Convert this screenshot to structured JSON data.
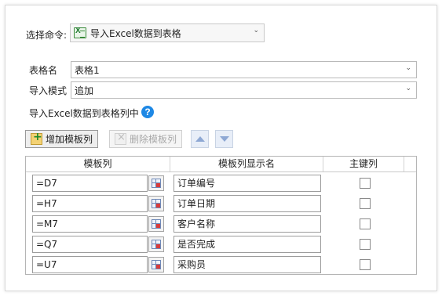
{
  "command": {
    "label": "选择命令:",
    "selected": "导入Excel数据到表格",
    "icon": "excel-import-icon"
  },
  "form": {
    "table_name_label": "表格名",
    "table_name_value": "表格1",
    "import_mode_label": "导入模式",
    "import_mode_value": "追加",
    "section_label": "导入Excel数据到表格列中",
    "help_symbol": "?"
  },
  "toolbar": {
    "add_label": "增加模板列",
    "delete_label": "删除模板列"
  },
  "grid": {
    "columns": [
      "模板列",
      "模板列显示名",
      "主键列"
    ],
    "rows": [
      {
        "template": "=D7",
        "display": "订单编号",
        "primary_key": false
      },
      {
        "template": "=H7",
        "display": "订单日期",
        "primary_key": false
      },
      {
        "template": "=M7",
        "display": "客户名称",
        "primary_key": false
      },
      {
        "template": "=Q7",
        "display": "是否完成",
        "primary_key": false
      },
      {
        "template": "=U7",
        "display": "采购员",
        "primary_key": false
      }
    ]
  },
  "colors": {
    "help": "#1e88e5",
    "arrow": "#8ea8d4",
    "border": "#b9b9b9"
  }
}
